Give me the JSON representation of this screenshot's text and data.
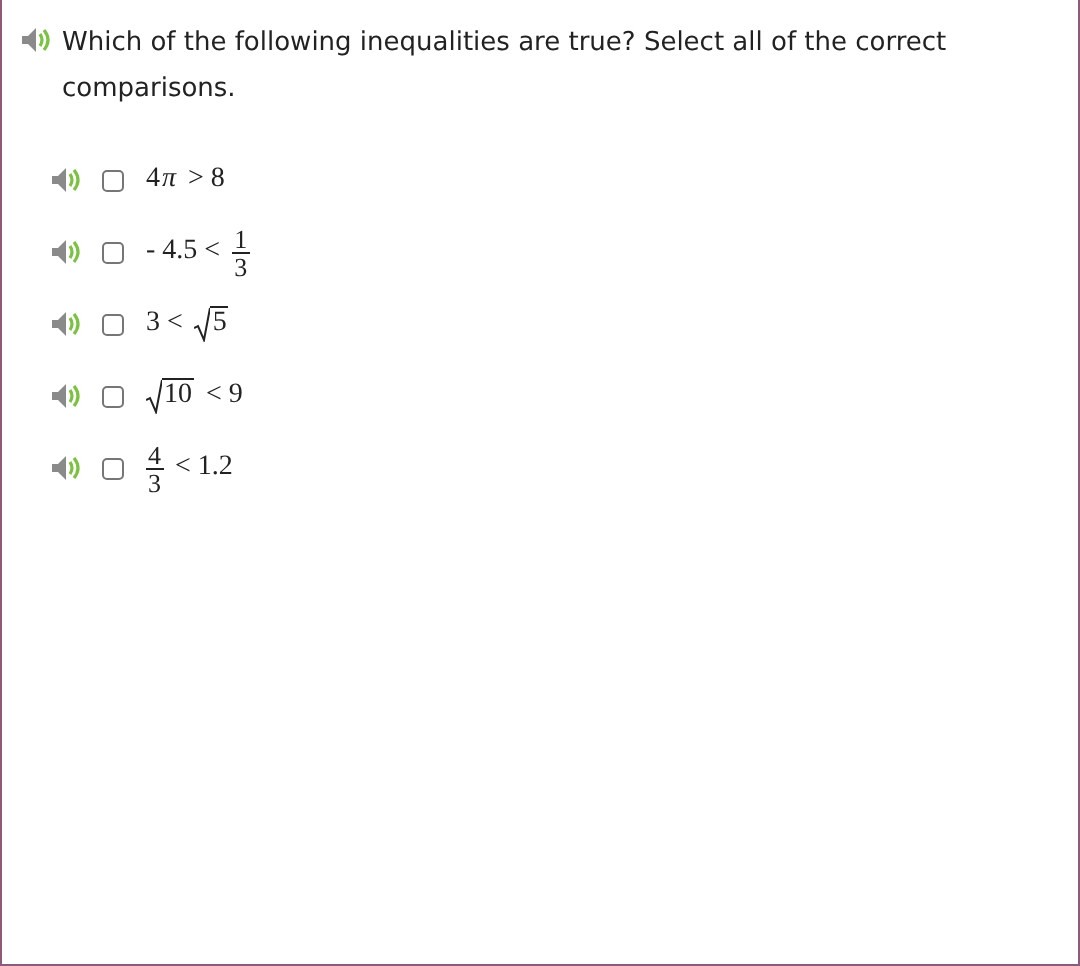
{
  "question": "Which of the following inequalities are true? Select all of the correct comparisons.",
  "options": [
    {
      "checked": false,
      "parts": [
        {
          "kind": "text",
          "text": "4"
        },
        {
          "kind": "var",
          "text": "π"
        },
        {
          "kind": "text",
          "text": "> 8"
        }
      ]
    },
    {
      "checked": false,
      "parts": [
        {
          "kind": "text",
          "text": "- 4.5 <"
        },
        {
          "kind": "frac",
          "num": "1",
          "den": "3"
        }
      ]
    },
    {
      "checked": false,
      "parts": [
        {
          "kind": "text",
          "text": "3 <"
        },
        {
          "kind": "sqrt",
          "radicand": "5"
        }
      ]
    },
    {
      "checked": false,
      "parts": [
        {
          "kind": "sqrt",
          "radicand": "10"
        },
        {
          "kind": "text",
          "text": "< 9"
        }
      ]
    },
    {
      "checked": false,
      "parts": [
        {
          "kind": "frac",
          "num": "4",
          "den": "3"
        },
        {
          "kind": "text",
          "text": "< 1.2"
        }
      ]
    }
  ]
}
